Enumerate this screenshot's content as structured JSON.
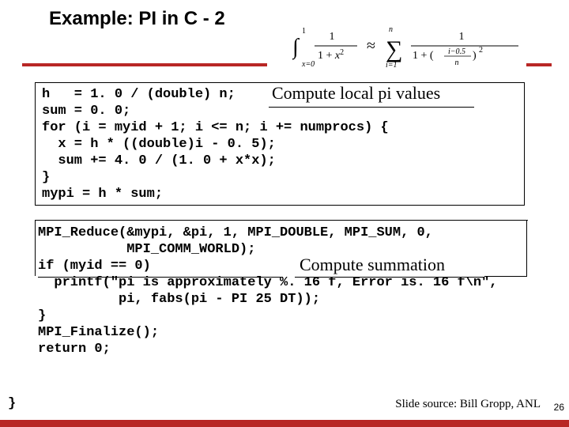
{
  "title": "Example:  PI in C - 2",
  "annot1": "Compute local pi values",
  "annot2": "Compute summation",
  "code1": "h   = 1. 0 / (double) n;\nsum = 0. 0;\nfor (i = myid + 1; i <= n; i += numprocs) {\n  x = h * ((double)i - 0. 5);\n  sum += 4. 0 / (1. 0 + x*x);\n}\nmypi = h * sum;",
  "code2": "MPI_Reduce(&mypi, &pi, 1, MPI_DOUBLE, MPI_SUM, 0,\n           MPI_COMM_WORLD);\nif (myid == 0)\n  printf(\"pi is approximately %. 16 f, Error is. 16 f\\n\",\n          pi, fabs(pi - PI 25 DT));\n}\nMPI_Finalize();\nreturn 0;",
  "closebrace": "}",
  "source_line": "Slide source: Bill Gropp, ANL",
  "page_number": "26",
  "formula_text": "∫[x=0 to 1] 1/(1+x²) ≈ Σ[i=1 to n] 1/(1+((i−0.5)/n)²)",
  "chart_data": {
    "type": "equation",
    "lhs": {
      "integral": {
        "from": "x=0",
        "to": "1",
        "integrand": "1 / (1 + x^2)"
      }
    },
    "relation": "≈",
    "rhs": {
      "sum": {
        "from": "i=1",
        "to": "n",
        "summand": "1 / (1 + ((i - 0.5)/n)^2)"
      }
    }
  }
}
